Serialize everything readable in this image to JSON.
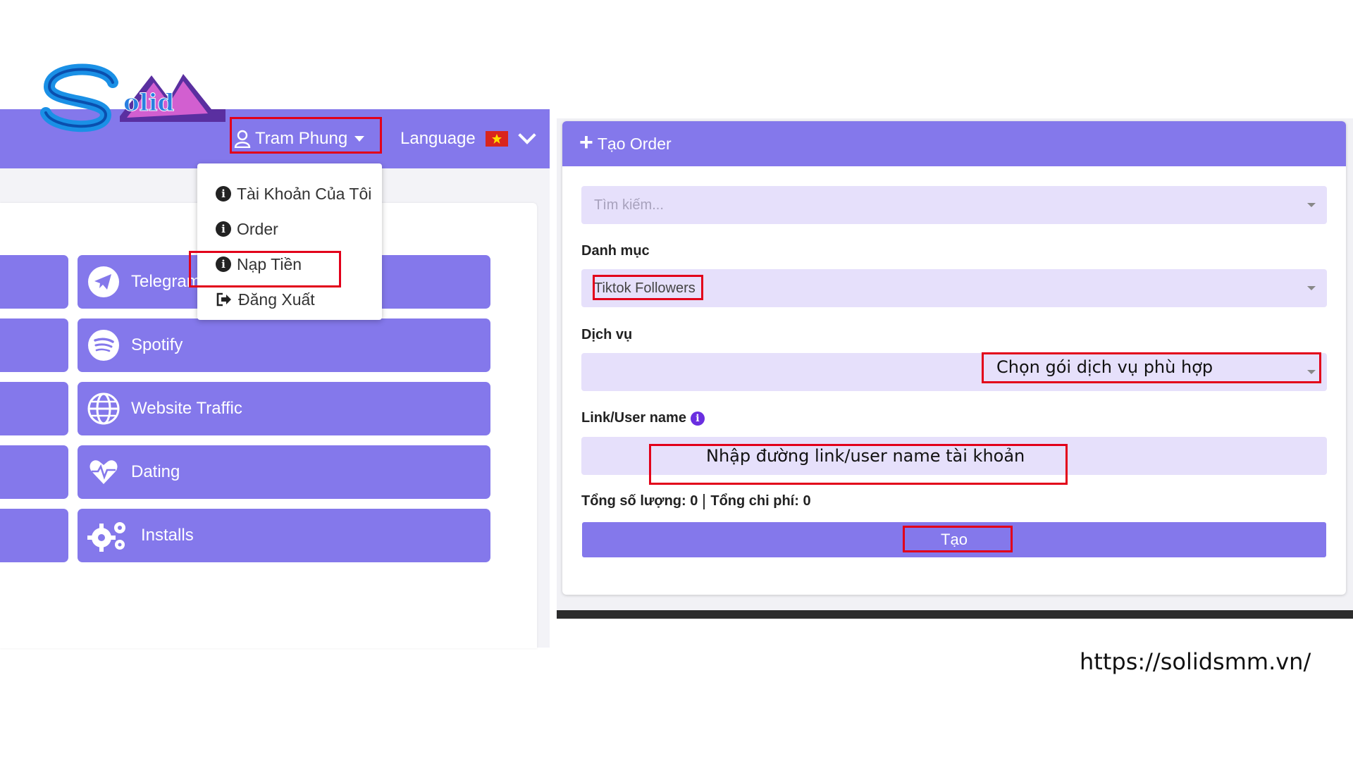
{
  "logo": {
    "text": "Solid"
  },
  "left": {
    "user_menu": {
      "label": "Tram Phung"
    },
    "language": {
      "label": "Language"
    },
    "dropdown": [
      {
        "label": "Tài Khoản Của Tôi",
        "icon": "info-icon"
      },
      {
        "label": "Order",
        "icon": "info-icon"
      },
      {
        "label": "Nạp Tiền",
        "icon": "info-icon"
      },
      {
        "label": "Đăng Xuất",
        "icon": "sign-out-icon"
      }
    ],
    "tiles": [
      {
        "label": "Telegram",
        "icon": "telegram-icon"
      },
      {
        "label": "Spotify",
        "icon": "spotify-icon"
      },
      {
        "label": "Website Traffic",
        "icon": "globe-icon"
      },
      {
        "label": "Dating",
        "icon": "heart-pulse-icon"
      },
      {
        "label": "Installs",
        "icon": "gears-icon"
      }
    ]
  },
  "form": {
    "title": "Tạo Order",
    "search_placeholder": "Tìm kiếm...",
    "category_label": "Danh mục",
    "category_value": "Tiktok Followers",
    "service_label": "Dịch vụ",
    "link_label": "Link/User name",
    "totals": {
      "quantity_label": "Tổng số lượng:",
      "quantity_value": "0",
      "cost_label": "Tổng chi phí:",
      "cost_value": "0"
    },
    "submit_label": "Tạo"
  },
  "annotations": {
    "service_hint": "Chọn gói dịch vụ phù hợp",
    "link_hint": "Nhập đường link/user name tài khoản"
  },
  "footer": {
    "url": "https://solidsmm.vn/"
  },
  "colors": {
    "primary": "#8478eb",
    "input_bg": "#e6e0fb",
    "annotation": "#e2001a"
  }
}
